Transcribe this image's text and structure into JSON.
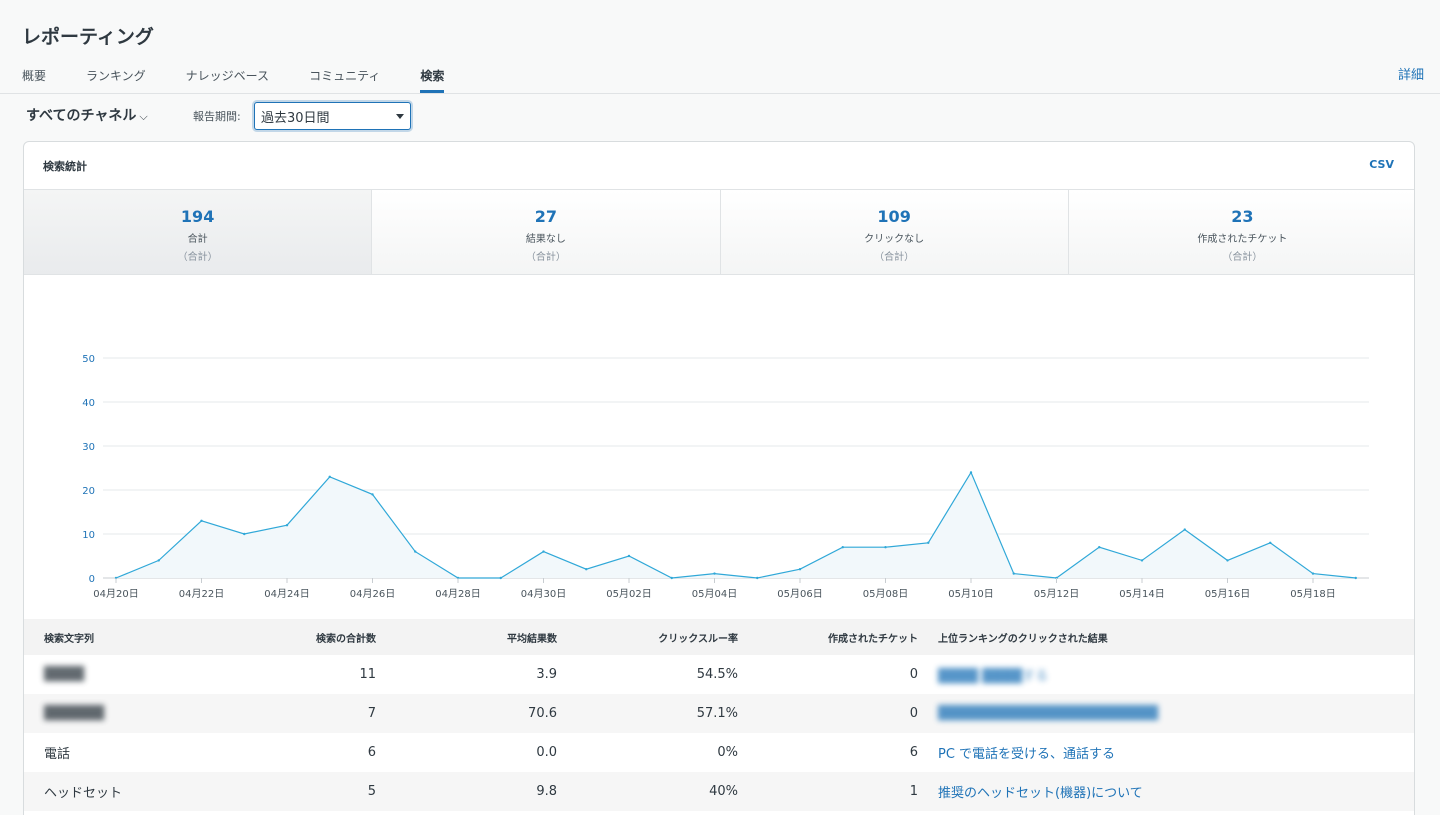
{
  "page": {
    "title": "レポーティング"
  },
  "tabs": [
    {
      "label": "概要",
      "active": false
    },
    {
      "label": "ランキング",
      "active": false
    },
    {
      "label": "ナレッジベース",
      "active": false
    },
    {
      "label": "コミュニティ",
      "active": false
    },
    {
      "label": "検索",
      "active": true
    }
  ],
  "header": {
    "detail_link": "詳細"
  },
  "filters": {
    "channel": "すべてのチャネル",
    "channel_chevron": "⌵",
    "period_label": "報告期間:",
    "period_value": "過去30日間"
  },
  "card": {
    "title": "検索統計",
    "csv": "CSV",
    "stats": [
      {
        "value": "194",
        "label": "合計",
        "sub": "（合計）",
        "active": true
      },
      {
        "value": "27",
        "label": "結果なし",
        "sub": "（合計）",
        "active": false
      },
      {
        "value": "109",
        "label": "クリックなし",
        "sub": "（合計）",
        "active": false
      },
      {
        "value": "23",
        "label": "作成されたチケット",
        "sub": "（合計）",
        "active": false
      }
    ]
  },
  "colors": {
    "accent": "#1f73b7",
    "line": "#30a8d8",
    "fill": "#f2f8fb",
    "axis_text": "#1f73b7"
  },
  "chart_data": {
    "type": "area",
    "x_tick_labels": [
      "04月20日",
      "04月22日",
      "04月24日",
      "04月26日",
      "04月28日",
      "04月30日",
      "05月02日",
      "05月04日",
      "05月06日",
      "05月08日",
      "05月10日",
      "05月12日",
      "05月14日",
      "05月16日",
      "05月18日"
    ],
    "dates": [
      "04/20",
      "04/21",
      "04/22",
      "04/23",
      "04/24",
      "04/25",
      "04/26",
      "04/27",
      "04/28",
      "04/29",
      "04/30",
      "05/01",
      "05/02",
      "05/03",
      "05/04",
      "05/05",
      "05/06",
      "05/07",
      "05/08",
      "05/09",
      "05/10",
      "05/11",
      "05/12",
      "05/13",
      "05/14",
      "05/15",
      "05/16",
      "05/17",
      "05/18",
      "05/19"
    ],
    "values": [
      0,
      4,
      13,
      10,
      12,
      23,
      19,
      6,
      0,
      0,
      6,
      2,
      5,
      0,
      1,
      0,
      2,
      7,
      7,
      8,
      24,
      1,
      0,
      7,
      4,
      11,
      4,
      8,
      1,
      0
    ],
    "ylim": [
      0,
      50
    ],
    "y_ticks": [
      0,
      10,
      20,
      30,
      40,
      50
    ],
    "grid": true,
    "legend": "none"
  },
  "table": {
    "headers": [
      "検索文字列",
      "検索の合計数",
      "平均結果数",
      "クリックスルー率",
      "作成されたチケット",
      "上位ランキングのクリックされた結果"
    ],
    "rows": [
      {
        "query": "████",
        "total": "11",
        "avg": "3.9",
        "ctr": "54.5%",
        "tickets": "0",
        "top": "████ ████する",
        "blurred": true
      },
      {
        "query": "██████",
        "total": "7",
        "avg": "70.6",
        "ctr": "57.1%",
        "tickets": "0",
        "top": "██████████████████████",
        "blurred": true
      },
      {
        "query": "電話",
        "total": "6",
        "avg": "0.0",
        "ctr": "0%",
        "tickets": "6",
        "top": "PC で電話を受ける、通話する",
        "blurred": false
      },
      {
        "query": "ヘッドセット",
        "total": "5",
        "avg": "9.8",
        "ctr": "40%",
        "tickets": "1",
        "top": "推奨のヘッドセット(機器)について",
        "blurred": false
      }
    ]
  }
}
